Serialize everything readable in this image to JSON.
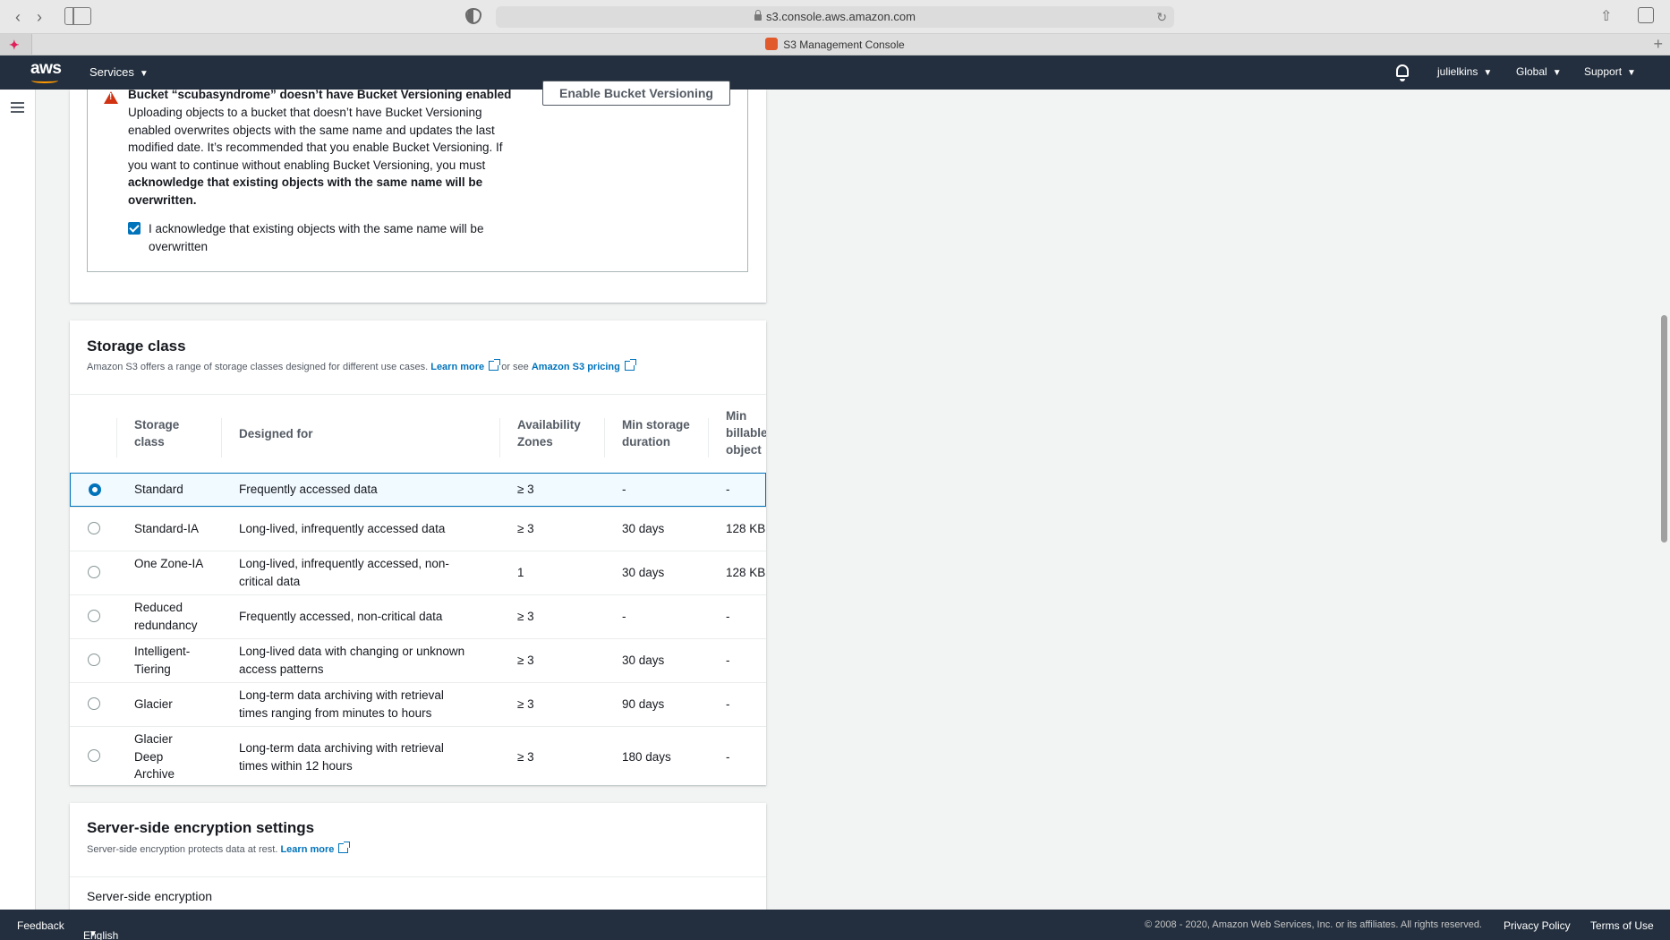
{
  "browser": {
    "url": "s3.console.aws.amazon.com",
    "tab_title": "S3 Management Console"
  },
  "top_nav": {
    "logo": "aws",
    "services_label": "Services",
    "account_label": "julielkins",
    "region_label": "Global",
    "support_label": "Support"
  },
  "versioning_warning": {
    "title": "Bucket “scubasyndrome” doesn’t have Bucket Versioning enabled",
    "body_plain": "Uploading objects to a bucket that doesn’t have Bucket Versioning enabled overwrites objects with the same name and updates the last modified date. It’s recommended that you enable Bucket Versioning. If you want to continue without enabling Bucket Versioning, you must ",
    "body_bold": "acknowledge that existing objects with the same name will be overwritten.",
    "enable_button": "Enable Bucket Versioning",
    "acknowledge_label": "I acknowledge that existing objects with the same name will be overwritten",
    "acknowledge_checked": true
  },
  "storage_class": {
    "title": "Storage class",
    "description": "Amazon S3 offers a range of storage classes designed for different use cases.",
    "learn_more": "Learn more",
    "or_see": "or see",
    "pricing_link": "Amazon S3 pricing",
    "columns": [
      "Storage class",
      "Designed for",
      "Availability Zones",
      "Min storage duration",
      "Min billable object"
    ],
    "selected_index": 0,
    "rows": [
      {
        "name": "Standard",
        "designed_for": "Frequently accessed data",
        "zones": "≥ 3",
        "min_duration": "-",
        "min_billable": "-"
      },
      {
        "name": "Standard-IA",
        "designed_for": "Long-lived, infrequently accessed data",
        "zones": "≥ 3",
        "min_duration": "30 days",
        "min_billable": "128 KB"
      },
      {
        "name": "One Zone-IA",
        "designed_for": "Long-lived, infrequently accessed, non-critical data",
        "zones": "1",
        "min_duration": "30 days",
        "min_billable": "128 KB"
      },
      {
        "name": "Reduced redundancy",
        "designed_for": "Frequently accessed, non-critical data",
        "zones": "≥ 3",
        "min_duration": "-",
        "min_billable": "-"
      },
      {
        "name": "Intelligent-Tiering",
        "designed_for": "Long-lived data with changing or unknown access patterns",
        "zones": "≥ 3",
        "min_duration": "30 days",
        "min_billable": "-"
      },
      {
        "name": "Glacier",
        "designed_for": "Long-term data archiving with retrieval times ranging from minutes to hours",
        "zones": "≥ 3",
        "min_duration": "90 days",
        "min_billable": "-"
      },
      {
        "name": "Glacier Deep Archive",
        "designed_for": "Long-term data archiving with retrieval times within 12 hours",
        "zones": "≥ 3",
        "min_duration": "180 days",
        "min_billable": "-"
      }
    ]
  },
  "encryption": {
    "title": "Server-side encryption settings",
    "description": "Server-side encryption protects data at rest.",
    "learn_more": "Learn more",
    "field_label": "Server-side encryption"
  },
  "footer": {
    "feedback": "Feedback",
    "language": "English (US)",
    "copyright": "© 2008 - 2020, Amazon Web Services, Inc. or its affiliates. All rights reserved.",
    "privacy": "Privacy Policy",
    "terms": "Terms of Use"
  },
  "colors": {
    "nav_bg": "#232f3e",
    "accent": "#0073bb",
    "warning": "#d13212",
    "brand_orange": "#ff9900"
  }
}
